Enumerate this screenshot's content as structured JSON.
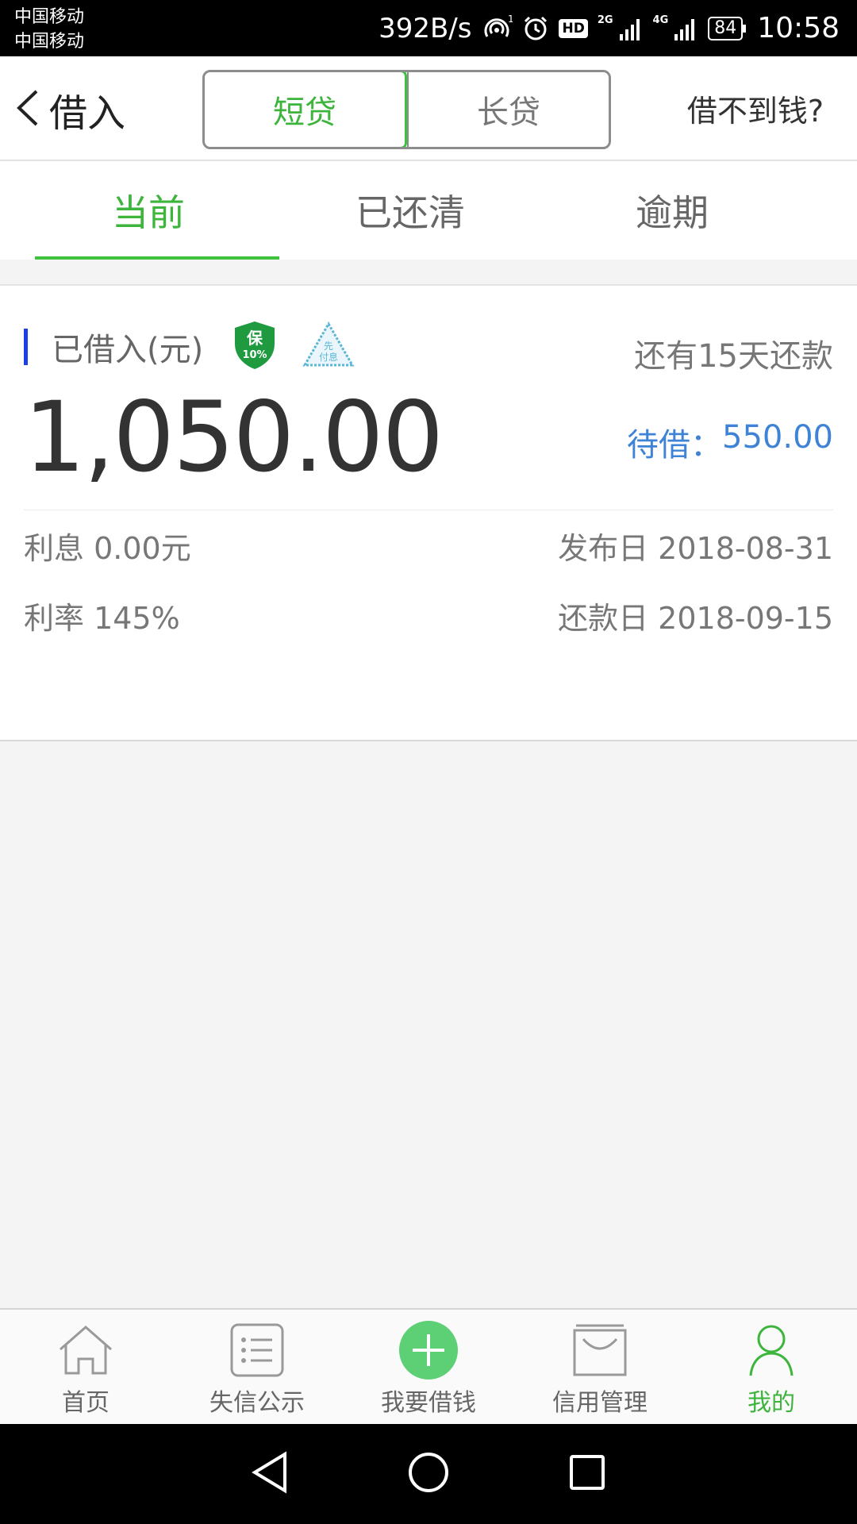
{
  "status_bar": {
    "carrier1": "中国移动",
    "carrier2": "中国移动",
    "speed": "392B/s",
    "hd": "HD",
    "net1": "2G",
    "net2": "4G",
    "battery": "84",
    "time": "10:58"
  },
  "header": {
    "title": "借入",
    "segments": [
      "短贷",
      "长贷"
    ],
    "help": "借不到钱?"
  },
  "tabs": [
    "当前",
    "已还清",
    "逾期"
  ],
  "card": {
    "label": "已借入(元)",
    "badge_shield_top": "保",
    "badge_shield_pct": "10%",
    "badge_tri_line1": "先",
    "badge_tri_line2": "付息",
    "days_left": "还有15天还款",
    "amount": "1,050.00",
    "pending_label": "待借：",
    "pending_value": "550.00",
    "interest": "利息 0.00元",
    "publish_date": "发布日 2018-08-31",
    "rate": "利率 145%",
    "repay_date": "还款日 2018-09-15"
  },
  "bottom_nav": [
    "首页",
    "失信公示",
    "我要借钱",
    "信用管理",
    "我的"
  ],
  "colors": {
    "accent": "#3db53d",
    "pending": "#3e83d6",
    "bar": "#1d3fe6"
  }
}
